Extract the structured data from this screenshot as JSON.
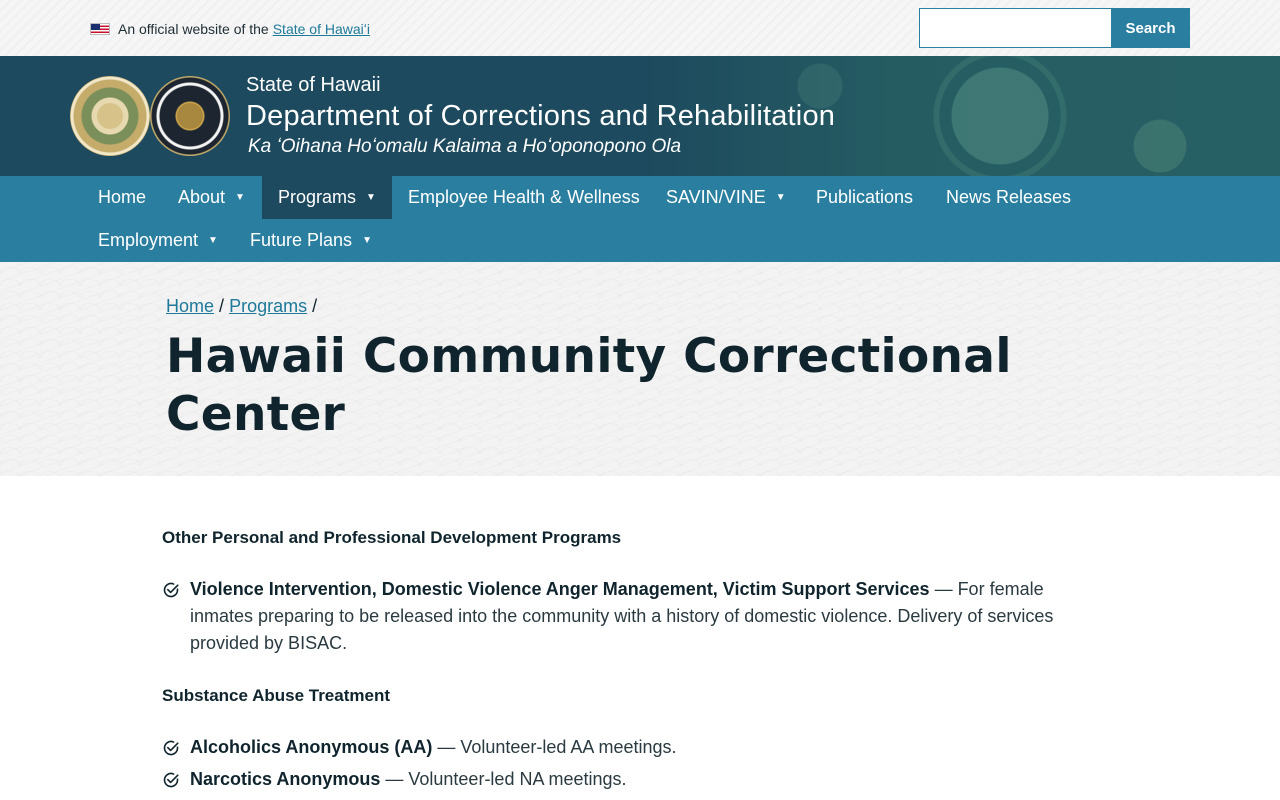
{
  "topbar": {
    "official_text": "An official website of the",
    "official_link": "State of Hawaiʻi",
    "search": {
      "placeholder": "",
      "button_label": "Search"
    }
  },
  "header": {
    "state": "State of Hawaii",
    "department": "Department of Corrections and Rehabilitation",
    "hawaiian_name": "Ka ʻOihana Hoʻomalu Kalaima a Hoʻoponopono Ola"
  },
  "nav": {
    "items": [
      {
        "label": "Home",
        "has_dropdown": false
      },
      {
        "label": "About",
        "has_dropdown": true
      },
      {
        "label": "Programs",
        "has_dropdown": true,
        "active": true
      },
      {
        "label": "Employee Health & Wellness",
        "has_dropdown": false
      },
      {
        "label": "SAVIN/VINE",
        "has_dropdown": true
      },
      {
        "label": "Publications",
        "has_dropdown": false
      },
      {
        "label": "News Releases",
        "has_dropdown": false
      },
      {
        "label": "Employment",
        "has_dropdown": true
      },
      {
        "label": "Future Plans",
        "has_dropdown": true
      }
    ],
    "caret": "▼"
  },
  "breadcrumb": {
    "items": [
      "Home",
      "Programs"
    ],
    "separator": "/"
  },
  "page": {
    "title": "Hawaii Community Correctional Center"
  },
  "content": {
    "sections": [
      {
        "heading": "Other Personal and Professional Development Programs",
        "items": [
          {
            "title": "Violence Intervention, Domestic Violence Anger Management, Victim Support Services",
            "description": " — For female inmates preparing to be released into the community with a history of domestic violence. Delivery of services provided by BISAC."
          }
        ]
      },
      {
        "heading": "Substance Abuse Treatment",
        "items": [
          {
            "title": "Alcoholics Anonymous (AA)",
            "description": " — Volunteer-led AA meetings."
          },
          {
            "title": "Narcotics Anonymous",
            "description": " — Volunteer-led NA meetings."
          }
        ]
      }
    ]
  },
  "colors": {
    "primary": "#2a7fa0",
    "dark": "#1d4a5e",
    "text": "#10242d"
  }
}
